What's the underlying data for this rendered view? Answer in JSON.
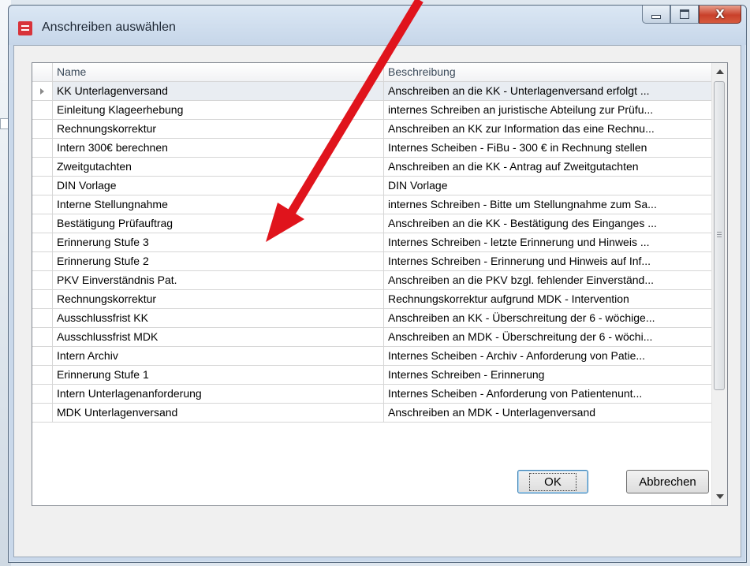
{
  "window": {
    "title": "Anschreiben auswählen",
    "close_glyph": "X"
  },
  "grid": {
    "columns": [
      "Name",
      "Beschreibung"
    ],
    "rows": [
      {
        "name": "KK Unterlagenversand",
        "desc": "Anschreiben an die KK - Unterlagenversand erfolgt ...",
        "selected": true
      },
      {
        "name": "Einleitung Klageerhebung",
        "desc": "internes Schreiben an juristische Abteilung zur Prüfu..."
      },
      {
        "name": "Rechnungskorrektur",
        "desc": "Anschreiben an KK zur Information das eine Rechnu..."
      },
      {
        "name": "Intern 300€ berechnen",
        "desc": "Internes Scheiben - FiBu - 300 € in Rechnung stellen"
      },
      {
        "name": "Zweitgutachten",
        "desc": "Anschreiben an die KK  - Antrag auf Zweitgutachten"
      },
      {
        "name": "DIN Vorlage",
        "desc": "DIN Vorlage"
      },
      {
        "name": "Interne Stellungnahme",
        "desc": "internes Schreiben - Bitte um Stellungnahme zum Sa..."
      },
      {
        "name": "Bestätigung Prüfauftrag",
        "desc": "Anschreiben an die KK - Bestätigung des Einganges ..."
      },
      {
        "name": "Erinnerung Stufe 3",
        "desc": "Internes Schreiben - letzte Erinnerung und Hinweis ..."
      },
      {
        "name": "Erinnerung Stufe 2",
        "desc": "Internes Schreiben - Erinnerung und Hinweis auf Inf..."
      },
      {
        "name": "PKV Einverständnis Pat.",
        "desc": "Anschreiben an die PKV bzgl. fehlender Einverständ..."
      },
      {
        "name": "Rechnungskorrektur",
        "desc": "Rechnungskorrektur aufgrund MDK - Intervention"
      },
      {
        "name": "Ausschlussfrist KK",
        "desc": "Anschreiben an KK - Überschreitung der 6 - wöchige..."
      },
      {
        "name": "Ausschlussfrist MDK",
        "desc": "Anschreiben an MDK - Überschreitung der 6 - wöchi..."
      },
      {
        "name": "Intern Archiv",
        "desc": "Internes Scheiben - Archiv - Anforderung von Patie..."
      },
      {
        "name": "Erinnerung Stufe 1",
        "desc": "Internes Schreiben - Erinnerung"
      },
      {
        "name": "Intern Unterlagenanforderung",
        "desc": "Internes Scheiben -  Anforderung von Patientenunt..."
      },
      {
        "name": "MDK Unterlagenversand",
        "desc": "Anschreiben an MDK - Unterlagenversand"
      }
    ]
  },
  "buttons": {
    "ok": "OK",
    "cancel": "Abbrechen"
  },
  "annotation": {
    "arrow_color": "#e0141c"
  }
}
